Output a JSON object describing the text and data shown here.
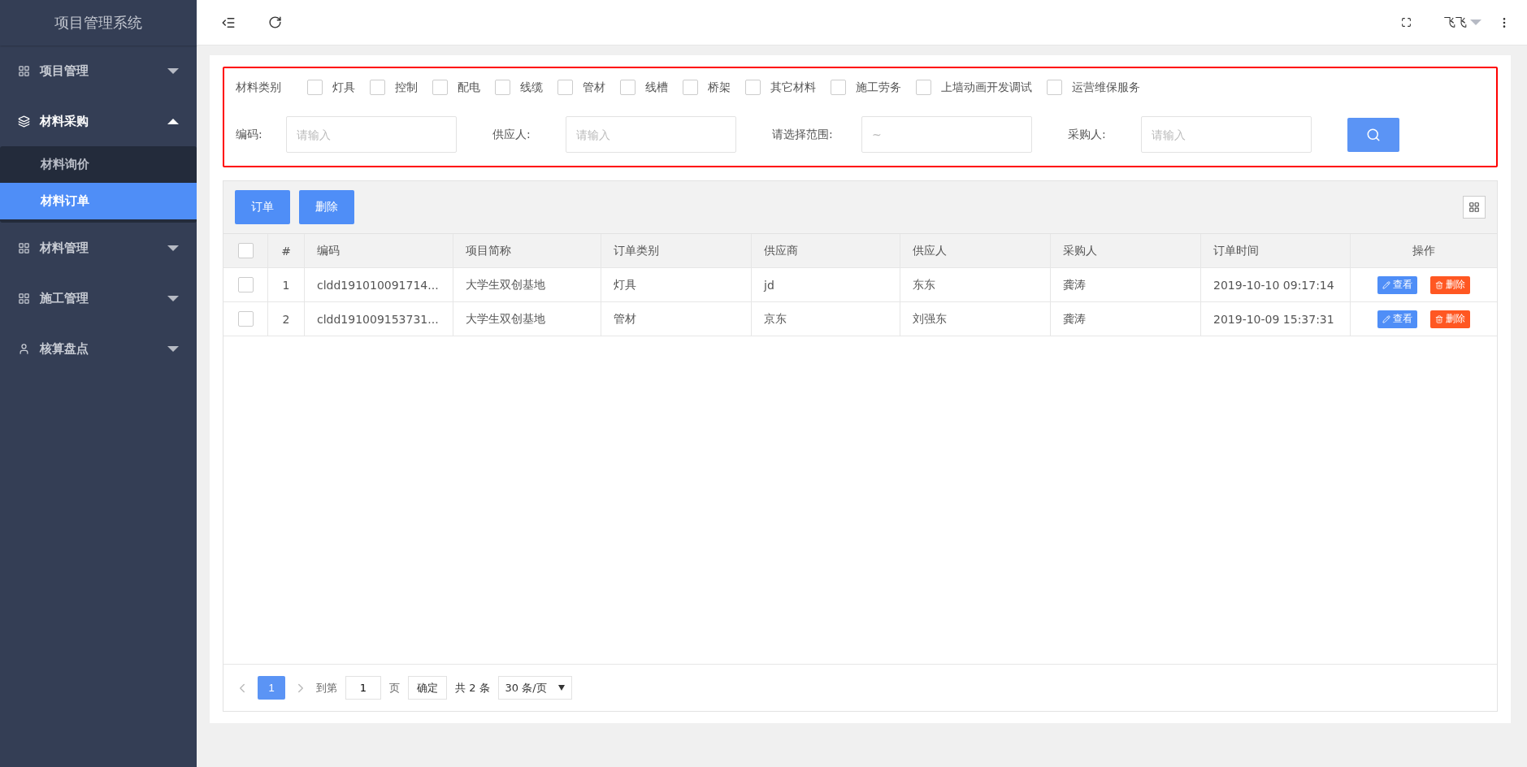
{
  "sidebar": {
    "title": "项目管理系统",
    "items": [
      {
        "label": "项目管理",
        "expanded": false
      },
      {
        "label": "材料采购",
        "expanded": true,
        "children": [
          {
            "label": "材料询价",
            "selected": false
          },
          {
            "label": "材料订单",
            "selected": true
          }
        ]
      },
      {
        "label": "材料管理",
        "expanded": false
      },
      {
        "label": "施工管理",
        "expanded": false
      },
      {
        "label": "核算盘点",
        "expanded": false
      }
    ]
  },
  "header": {
    "user": "飞飞"
  },
  "filter": {
    "category_label": "材料类别",
    "categories": [
      {
        "label": "灯具",
        "checked": false
      },
      {
        "label": "控制",
        "checked": false
      },
      {
        "label": "配电",
        "checked": false
      },
      {
        "label": "线缆",
        "checked": false
      },
      {
        "label": "管材",
        "checked": false
      },
      {
        "label": "线槽",
        "checked": false
      },
      {
        "label": "桥架",
        "checked": false
      },
      {
        "label": "其它材料",
        "checked": false
      },
      {
        "label": "施工劳务",
        "checked": false
      },
      {
        "label": "上墙动画开发调试",
        "checked": false
      },
      {
        "label": "运营维保服务",
        "checked": false
      }
    ],
    "fields": [
      {
        "label": "编码:",
        "placeholder": "请输入"
      },
      {
        "label": "供应人:",
        "placeholder": "请输入"
      },
      {
        "label": "请选择范围:",
        "placeholder": "~"
      },
      {
        "label": "采购人:",
        "placeholder": "请输入"
      }
    ]
  },
  "toolbar": {
    "buttons": [
      "订单",
      "删除"
    ]
  },
  "table": {
    "select_all": false,
    "columns": [
      "#",
      "编码",
      "项目简称",
      "订单类别",
      "供应商",
      "供应人",
      "采购人",
      "订单时间",
      "操作"
    ],
    "rows": [
      {
        "checked": false,
        "cells": [
          "1",
          "cldd191010091714...",
          "大学生双创基地",
          "灯具",
          "jd",
          "东东",
          "龚涛",
          "2019-10-10 09:17:14"
        ],
        "actions": [
          "查看",
          "删除"
        ]
      },
      {
        "checked": false,
        "cells": [
          "2",
          "cldd191009153731...",
          "大学生双创基地",
          "管材",
          "京东",
          "刘强东",
          "龚涛",
          "2019-10-09 15:37:31"
        ],
        "actions": [
          "查看",
          "删除"
        ]
      }
    ]
  },
  "pagination": {
    "pages": [
      {
        "label": "1",
        "selected": true
      }
    ],
    "goto_label": "到第",
    "goto_value": "1",
    "page_unit": "页",
    "confirm": "确定",
    "total": "共 2 条",
    "page_size": "30 条/页"
  }
}
